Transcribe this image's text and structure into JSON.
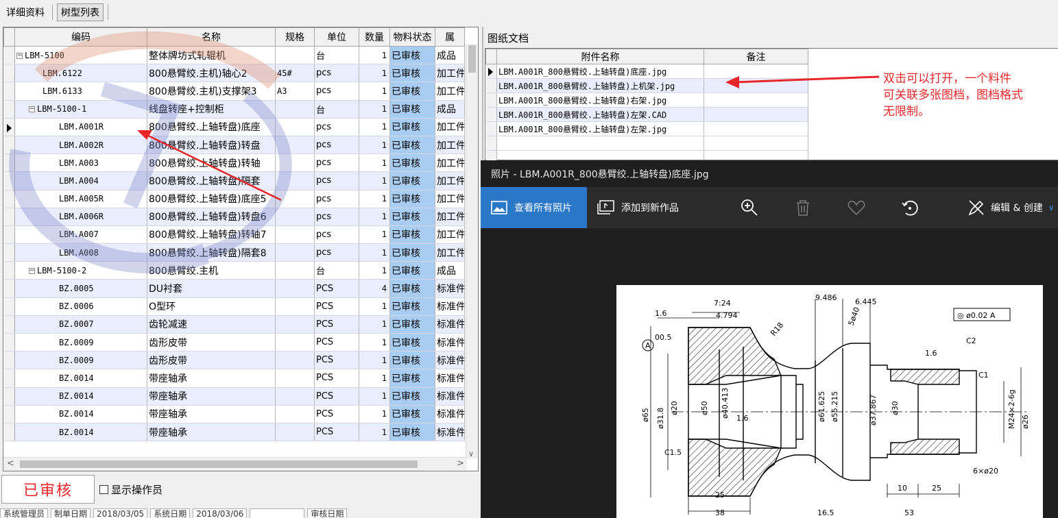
{
  "tabs": [
    {
      "label": "详细资料"
    },
    {
      "label": "树型列表"
    }
  ],
  "grid": {
    "headers": [
      "编码",
      "名称",
      "规格",
      "单位",
      "数量",
      "物料状态",
      "属"
    ],
    "rows": [
      {
        "code": "LBM-5100",
        "name": "整体牌坊式轧辊机",
        "spec": "",
        "unit": "台",
        "qty": "1",
        "status": "已审核",
        "type": "成品"
      },
      {
        "code": "LBM.6122",
        "name": "800悬臂绞.主机)轴心2",
        "spec": "45#",
        "unit": "pcs",
        "qty": "1",
        "status": "已审核",
        "type": "加工件"
      },
      {
        "code": "LBM.6133",
        "name": "800悬臂绞.主机)支撑架3",
        "spec": "A3",
        "unit": "pcs",
        "qty": "1",
        "status": "已审核",
        "type": "加工件"
      },
      {
        "code": "LBM-5100-1",
        "name": "线盘转座+控制柜",
        "spec": "",
        "unit": "台",
        "qty": "1",
        "status": "已审核",
        "type": "成品"
      },
      {
        "code": "LBM.A001R",
        "name": "800悬臂绞.上轴转盘)底座",
        "spec": "",
        "unit": "pcs",
        "qty": "1",
        "status": "已审核",
        "type": "加工件"
      },
      {
        "code": "LBM.A002R",
        "name": "800悬臂绞.上轴转盘)转盘",
        "spec": "",
        "unit": "pcs",
        "qty": "1",
        "status": "已审核",
        "type": "加工件"
      },
      {
        "code": "LBM.A003",
        "name": "800悬臂绞.上轴转盘)转轴",
        "spec": "",
        "unit": "pcs",
        "qty": "1",
        "status": "已审核",
        "type": "加工件"
      },
      {
        "code": "LBM.A004",
        "name": "800悬臂绞.上轴转盘)隔套",
        "spec": "",
        "unit": "pcs",
        "qty": "1",
        "status": "已审核",
        "type": "加工件"
      },
      {
        "code": "LBM.A005R",
        "name": "800悬臂绞.上轴转盘)底座5",
        "spec": "",
        "unit": "pcs",
        "qty": "1",
        "status": "已审核",
        "type": "加工件"
      },
      {
        "code": "LBM.A006R",
        "name": "800悬臂绞.上轴转盘)转盘6",
        "spec": "",
        "unit": "pcs",
        "qty": "1",
        "status": "已审核",
        "type": "加工件"
      },
      {
        "code": "LBM.A007",
        "name": "800悬臂绞.上轴转盘)转轴7",
        "spec": "",
        "unit": "pcs",
        "qty": "1",
        "status": "已审核",
        "type": "加工件"
      },
      {
        "code": "LBM.A008",
        "name": "800悬臂绞.上轴转盘)隔套8",
        "spec": "",
        "unit": "pcs",
        "qty": "1",
        "status": "已审核",
        "type": "加工件"
      },
      {
        "code": "LBM-5100-2",
        "name": "800悬臂绞.主机",
        "spec": "",
        "unit": "台",
        "qty": "1",
        "status": "已审核",
        "type": "成品"
      },
      {
        "code": "BZ.0005",
        "name": "DU衬套",
        "spec": "",
        "unit": "PCS",
        "qty": "4",
        "status": "已审核",
        "type": "标准件"
      },
      {
        "code": "BZ.0006",
        "name": "O型环",
        "spec": "",
        "unit": "PCS",
        "qty": "1",
        "status": "已审核",
        "type": "标准件"
      },
      {
        "code": "BZ.0007",
        "name": "齿轮减速",
        "spec": "",
        "unit": "PCS",
        "qty": "1",
        "status": "已审核",
        "type": "标准件"
      },
      {
        "code": "BZ.0009",
        "name": "齿形皮带",
        "spec": "",
        "unit": "PCS",
        "qty": "1",
        "status": "已审核",
        "type": "标准件"
      },
      {
        "code": "BZ.0009",
        "name": "齿形皮带",
        "spec": "",
        "unit": "PCS",
        "qty": "1",
        "status": "已审核",
        "type": "标准件"
      },
      {
        "code": "BZ.0014",
        "name": "带座轴承",
        "spec": "",
        "unit": "PCS",
        "qty": "1",
        "status": "已审核",
        "type": "标准件"
      },
      {
        "code": "BZ.0014",
        "name": "带座轴承",
        "spec": "",
        "unit": "PCS",
        "qty": "1",
        "status": "已审核",
        "type": "标准件"
      },
      {
        "code": "BZ.0014",
        "name": "带座轴承",
        "spec": "",
        "unit": "PCS",
        "qty": "1",
        "status": "已审核",
        "type": "标准件"
      },
      {
        "code": "BZ.0014",
        "name": "带座轴承",
        "spec": "",
        "unit": "PCS",
        "qty": "1",
        "status": "已审核",
        "type": "标准件"
      }
    ]
  },
  "status_stamp": "已审核",
  "show_operator_label": "显示操作员",
  "footer_fields": [
    "系统管理员",
    "制单日期",
    "2018/03/05",
    "系统日期",
    "2018/03/06",
    "",
    "审核日期"
  ],
  "doc_panel": {
    "title": "图纸文档",
    "headers": [
      "附件名称",
      "备注"
    ],
    "rows": [
      {
        "name": "LBM.A001R_800悬臂绞.上轴转盘)底座.jpg",
        "note": ""
      },
      {
        "name": "LBM.A001R_800悬臂绞.上轴转盘)上机架.jpg",
        "note": ""
      },
      {
        "name": "LBM.A001R_800悬臂绞.上轴转盘)右架.jpg",
        "note": ""
      },
      {
        "name": "LBM.A001R_800悬臂绞.上轴转盘)左架.CAD",
        "note": ""
      },
      {
        "name": "LBM.A001R_800悬臂绞.上轴转盘)左架.jpg",
        "note": ""
      }
    ]
  },
  "annotation": [
    "双击可以打开，一个料件",
    "可关联多张图档，图档格式",
    "无限制。"
  ],
  "viewer": {
    "title": "照片 - LBM.A001R_800悬臂绞.上轴转盘)底座.jpg",
    "see_all": "查看所有照片",
    "add_to": "添加到新作品",
    "edit": "编辑 & 创建",
    "icons": [
      "zoom-in-icon",
      "delete-icon",
      "heart-icon",
      "rotate-icon"
    ]
  },
  "drawing": {
    "labels": [
      "7:24",
      "1.6",
      "4.794",
      "9.486",
      "6.445",
      "⊙",
      "ø0.02",
      "A",
      "00.5",
      "R18",
      "5ø40",
      "C2",
      "1.6",
      "C1",
      "C1.5",
      "1.6",
      "ø50",
      "ø40.413",
      "ø61.625",
      "ø55.215",
      "ø37.867",
      "ø30",
      "M24×2-6g",
      "ø26",
      "ø20",
      "ø31.8",
      "ø65",
      "6×ø20",
      "25",
      "10",
      "25",
      "38",
      "16.5",
      "53"
    ]
  },
  "colors": {
    "accent": "#2b78c9",
    "status_fill": "#a9cdf2",
    "annotation": "#e8262a"
  }
}
